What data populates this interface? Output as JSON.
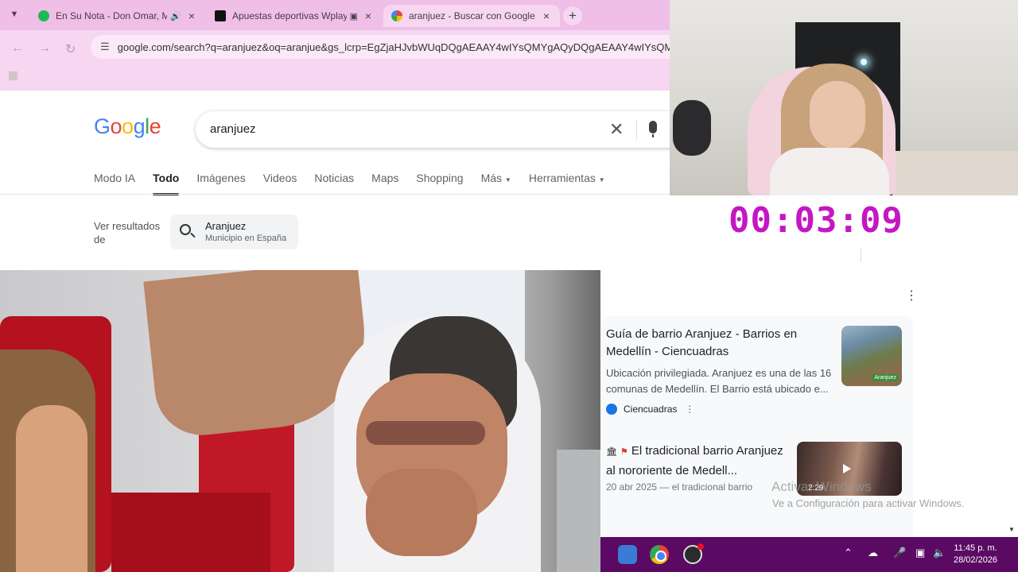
{
  "browser": {
    "tabs": [
      {
        "title": "En Su Nota - Don Omar, Maluma",
        "favicon_color": "#1db954",
        "audio": "speaker-icon",
        "active": false
      },
      {
        "title": "Apuestas deportivas Wplay",
        "favicon_color": "#111111",
        "audio": "pip-icon",
        "active": false
      },
      {
        "title": "aranjuez - Buscar con Google",
        "favicon_color": "#4285f4",
        "active": true
      }
    ],
    "new_tab_label": "+",
    "url": "google.com/search?q=aranjuez&oq=aranjue&gs_lcrp=EgZjaHJvbWUqDQgAEAAY4wIYsQMYgAQyDQgAEAAY4wIYsQMYgAQ"
  },
  "google": {
    "logo": "Google",
    "query": "aranjuez",
    "nav_tabs": [
      "Modo IA",
      "Todo",
      "Imágenes",
      "Videos",
      "Noticias",
      "Maps",
      "Shopping",
      "Más",
      "Herramientas"
    ],
    "active_tab": "Todo",
    "ver_resultados_label": "Ver resultados de",
    "chip": {
      "title": "Aranjuez",
      "subtitle": "Municipio en España"
    }
  },
  "results": [
    {
      "title": "Guía de barrio Aranjuez - Barrios en Medellín - Ciencuadras",
      "snippet": "Ubicación privilegiada. Aranjuez es una de las 16 comunas de Medellín. El Barrio está ubicado e...",
      "source": "Ciencuadras",
      "thumb_label": "Aranjuez"
    },
    {
      "title": "El tradicional barrio Aranjuez al nororiente de Medell...",
      "date": "20 abr 2025 — el tradicional barrio",
      "duration": "2:29"
    }
  ],
  "watermark": {
    "line1": "Activar Windows",
    "line2": "Ve a Configuración para activar Windows."
  },
  "timer": "00:03:09",
  "taskbar": {
    "time": "11:45 p. m.",
    "date": "28/02/2026"
  },
  "colors": {
    "tabstrip": "#efbfe8",
    "toolbar": "#f6d6f1",
    "timer": "#c417c4",
    "taskbar": "#5a0a63"
  }
}
